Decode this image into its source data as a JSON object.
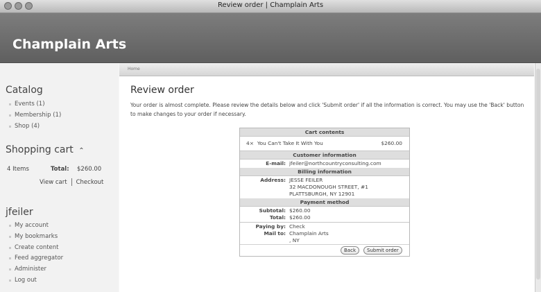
{
  "window": {
    "title": "Review order | Champlain Arts"
  },
  "site": {
    "name": "Champlain Arts"
  },
  "sidebar": {
    "catalog": {
      "title": "Catalog",
      "items": [
        "Events (1)",
        "Membership (1)",
        "Shop (4)"
      ]
    },
    "cart": {
      "title": "Shopping cart",
      "arrow": "⌃",
      "items": "4 Items",
      "total_label": "Total:",
      "total_value": "$260.00",
      "view_cart": "View cart",
      "checkout": "Checkout"
    },
    "user": {
      "name": "jfeiler",
      "items": [
        "My account",
        "My bookmarks",
        "Create content",
        "Feed aggregator",
        "Administer",
        "Log out"
      ]
    }
  },
  "main": {
    "breadcrumb": "Home",
    "title": "Review order",
    "intro": "Your order is almost complete. Please review the details below and click 'Submit order' if all the information is correct. You may use the 'Back' button to make changes to your order if necessary."
  },
  "order": {
    "cart_header": "Cart contents",
    "cart_qty": "4×",
    "cart_item": "You Can't Take It With You",
    "cart_price": "$260.00",
    "customer_header": "Customer information",
    "email_label": "E-mail:",
    "email_value": "jfeiler@northcountryconsulting.com",
    "billing_header": "Billing information",
    "address_label": "Address:",
    "address_line1": "JESSE FEILER",
    "address_line2": "32 MACDONOUGH STREET, #1",
    "address_line3": "PLATTSBURGH, NY 12901",
    "payment_header": "Payment method",
    "subtotal_label": "Subtotal:",
    "subtotal_value": "$260.00",
    "total_label": "Total:",
    "total_value": "$260.00",
    "paying_by_label": "Paying by:",
    "paying_by_value": "Check",
    "mail_to_label": "Mail to:",
    "mail_to_line1": "Champlain Arts",
    "mail_to_line2": ", NY",
    "back_button": "Back",
    "submit_button": "Submit order"
  }
}
